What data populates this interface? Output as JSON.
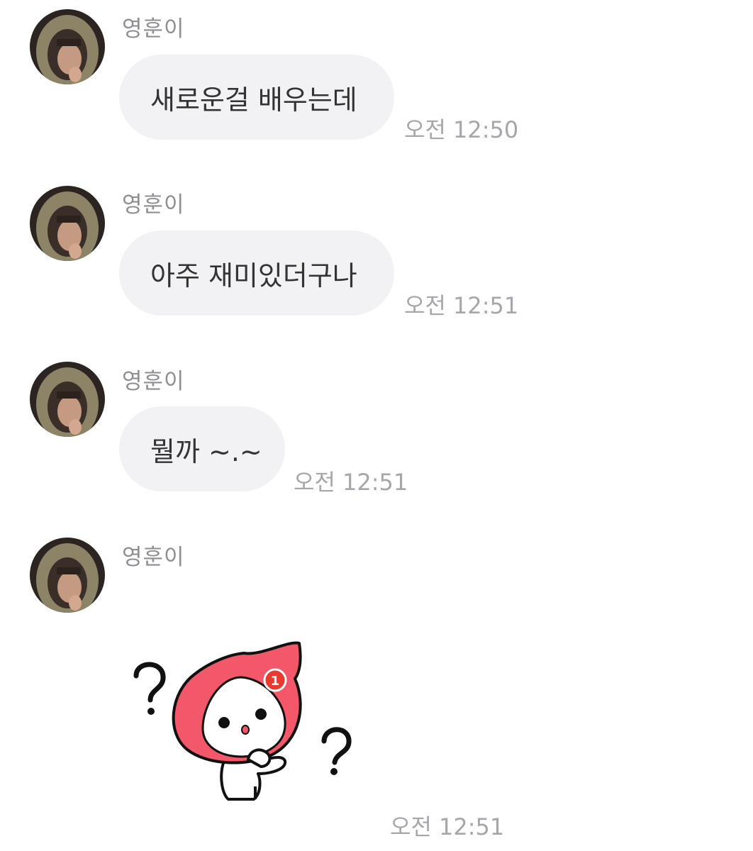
{
  "messages": [
    {
      "sender": "영훈이",
      "text": "새로운걸 배우는데",
      "time": "오전 12:50"
    },
    {
      "sender": "영훈이",
      "text": "아주 재미있더구나",
      "time": "오전 12:51"
    },
    {
      "sender": "영훈이",
      "text": "뭘까 ~.~",
      "time": "오전 12:51"
    },
    {
      "sender": "영훈이",
      "sticker": "red-hooded-character-question-marks-sticker",
      "sticker_badge": "1",
      "time": "오전 12:51"
    }
  ],
  "colors": {
    "bubble": "#f2f2f5",
    "sender_text": "#8e8e93",
    "time_text": "#a7a7ab",
    "message_text": "#333333",
    "sticker_hood": "#f2576a",
    "sticker_badge": "#e93a2e"
  },
  "icons": {
    "avatar": "profile-photo-hooded-person"
  }
}
